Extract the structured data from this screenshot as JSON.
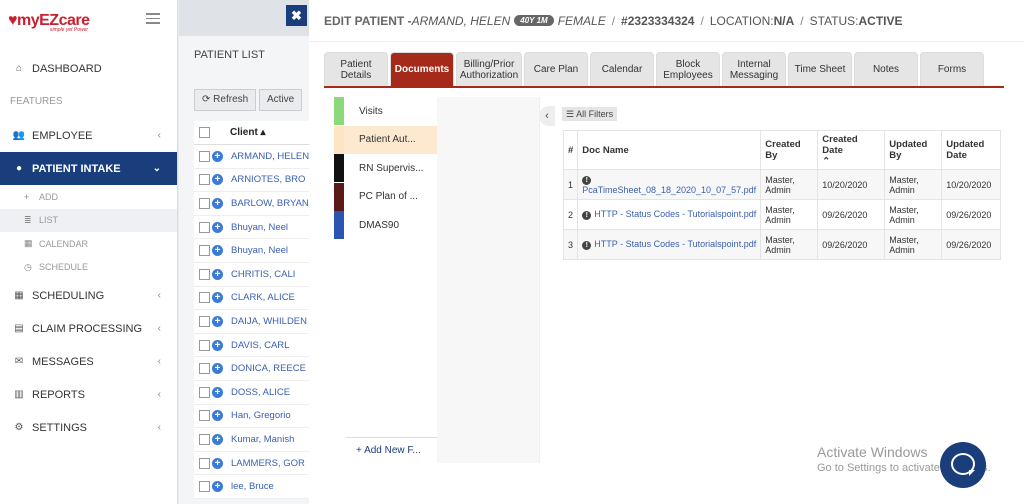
{
  "app": {
    "logo_main": "myEZcare",
    "logo_tag": "simple yet Power"
  },
  "sidebar": {
    "items": [
      {
        "label": "DASHBOARD",
        "icon": "home-icon"
      },
      {
        "section": "FEATURES"
      },
      {
        "label": "EMPLOYEE",
        "icon": "users-icon"
      },
      {
        "label": "PATIENT INTAKE",
        "icon": "user-icon"
      },
      {
        "label": "SCHEDULING",
        "icon": "calendar-icon"
      },
      {
        "label": "CLAIM PROCESSING",
        "icon": "file-icon"
      },
      {
        "label": "MESSAGES",
        "icon": "envelope-icon"
      },
      {
        "label": "REPORTS",
        "icon": "bar-chart-icon"
      },
      {
        "label": "SETTINGS",
        "icon": "gear-icon"
      }
    ],
    "sub": [
      "ADD",
      "LIST",
      "CALENDAR",
      "SCHEDULE"
    ]
  },
  "patient_list": {
    "title": "PATIENT LIST",
    "refresh": "Refresh",
    "active": "Active",
    "column": "Client",
    "rows": [
      "ARMAND, HELEN",
      "ARNIOTES, BRO",
      "BARLOW, BRYAN",
      "Bhuyan, Neel",
      "Bhuyan, Neel",
      "CHRITIS, CALI",
      "CLARK, ALICE",
      "DAIJA, WHILDEN",
      "DAVIS, CARL",
      "DONICA, REECE",
      "DOSS, ALICE",
      "Han, Gregorio",
      "Kumar, Manish",
      "LAMMERS, GOR",
      "lee, Bruce"
    ]
  },
  "header": {
    "title": "EDIT PATIENT - ",
    "name": "ARMAND, HELEN",
    "age": "40Y 1M",
    "gender": "FEMALE",
    "id": "#2323334324",
    "location_label": "LOCATION: ",
    "location": "N/A",
    "status_label": "STATUS: ",
    "status": "ACTIVE"
  },
  "tabs": [
    {
      "label": "Patient Details"
    },
    {
      "label": "Documents"
    },
    {
      "label": "Billing/Prior Authorization"
    },
    {
      "label": "Care Plan"
    },
    {
      "label": "Calendar"
    },
    {
      "label": "Block Employees"
    },
    {
      "label": "Internal Messaging"
    },
    {
      "label": "Time Sheet"
    },
    {
      "label": "Notes"
    },
    {
      "label": "Forms"
    }
  ],
  "categories": [
    {
      "label": "Visits",
      "color": "#8bd97a"
    },
    {
      "label": "Patient Aut...",
      "color": "#fde4c4"
    },
    {
      "label": "RN Supervis...",
      "color": "#111111"
    },
    {
      "label": "PC Plan of ...",
      "color": "#5a1a1a"
    },
    {
      "label": "DMAS90",
      "color": "#2a55b0"
    }
  ],
  "add_new": "+ Add New F...",
  "filters": "All Filters",
  "table": {
    "headers": [
      "#",
      "Doc Name",
      "Created By",
      "Created Date",
      "Updated By",
      "Updated Date"
    ],
    "rows": [
      {
        "n": "1",
        "doc": "PcaTimeSheet_08_18_2020_10_07_57.pdf",
        "created_by": "Master, Admin",
        "created_date": "10/20/2020",
        "updated_by": "Master, Admin",
        "updated_date": "10/20/2020"
      },
      {
        "n": "2",
        "doc": "HTTP - Status Codes - Tutorialspoint.pdf",
        "created_by": "Master, Admin",
        "created_date": "09/26/2020",
        "updated_by": "Master, Admin",
        "updated_date": "09/26/2020"
      },
      {
        "n": "3",
        "doc": "HTTP - Status Codes - Tutorialspoint.pdf",
        "created_by": "Master, Admin",
        "created_date": "09/26/2020",
        "updated_by": "Master, Admin",
        "updated_date": "09/26/2020"
      }
    ]
  },
  "watermark": {
    "line1": "Activate Windows",
    "line2": "Go to Settings to activate Windows."
  }
}
